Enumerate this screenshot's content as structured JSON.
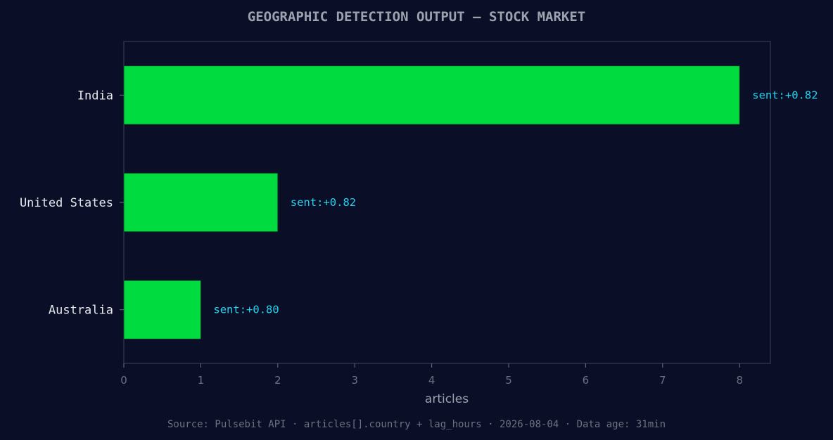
{
  "chart_data": {
    "type": "bar",
    "orientation": "horizontal",
    "title": "GEOGRAPHIC DETECTION OUTPUT — STOCK MARKET",
    "categories": [
      "India",
      "United States",
      "Australia"
    ],
    "values": [
      8,
      2,
      1
    ],
    "data_labels": [
      "sent:+0.82",
      "sent:+0.82",
      "sent:+0.80"
    ],
    "xlabel": "articles",
    "ylabel": "",
    "xlim": [
      0,
      8.4
    ],
    "xticks": [
      0,
      1,
      2,
      3,
      4,
      5,
      6,
      7,
      8
    ],
    "grid": false,
    "legend": "none",
    "colors": {
      "background": "#0a0e27",
      "bar": "#00dc3f",
      "data_label": "#22d3ee",
      "axis": "#2b3150"
    }
  },
  "footer": {
    "source": "Source: Pulsebit API · articles[].country + lag_hours · 2026-08-04 · Data age: 31min"
  }
}
